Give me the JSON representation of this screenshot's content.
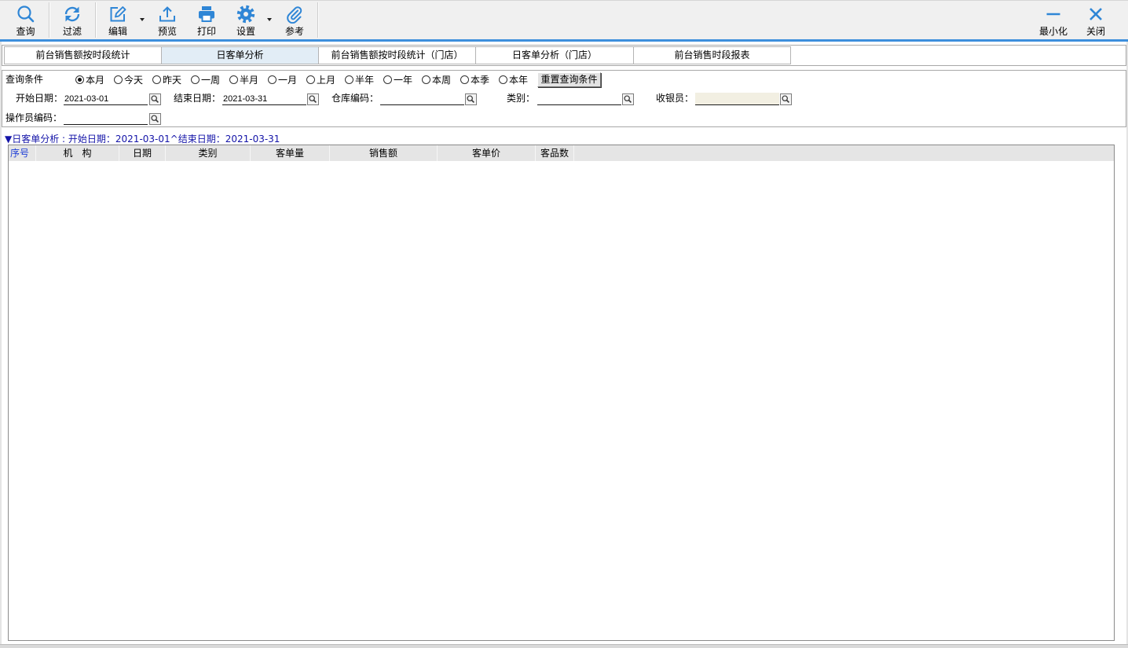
{
  "colors": {
    "accent": "#2f86d6",
    "toolbar_bg": "#f0f0f0",
    "divider_blue": "#3d8fdc",
    "active_tab_bg": "#e2edf6",
    "grid_header_bg": "#e5e5e5",
    "caption_text": "#1414a8",
    "header_blue_text": "#1f3fd6",
    "readonly_input_bg": "#f2efe2"
  },
  "toolbar": {
    "query": {
      "label": "查询",
      "icon": "search-icon"
    },
    "filter": {
      "label": "过滤",
      "icon": "refresh-icon"
    },
    "edit": {
      "label": "编辑",
      "icon": "edit-icon"
    },
    "preview": {
      "label": "预览",
      "icon": "upload-icon"
    },
    "print": {
      "label": "打印",
      "icon": "print-icon"
    },
    "settings": {
      "label": "设置",
      "icon": "gear-icon"
    },
    "reference": {
      "label": "参考",
      "icon": "paperclip-icon"
    },
    "minimize": {
      "label": "最小化",
      "icon": "minimize-icon"
    },
    "close": {
      "label": "关闭",
      "icon": "close-icon"
    }
  },
  "tabs": [
    {
      "label": "前台销售额按时段统计",
      "active": false
    },
    {
      "label": "日客单分析",
      "active": true
    },
    {
      "label": "前台销售额按时段统计（门店）",
      "active": false
    },
    {
      "label": "日客单分析（门店）",
      "active": false
    },
    {
      "label": "前台销售时段报表",
      "active": false
    }
  ],
  "query": {
    "title": "查询条件",
    "periods": [
      {
        "label": "本月",
        "selected": true
      },
      {
        "label": "今天",
        "selected": false
      },
      {
        "label": "昨天",
        "selected": false
      },
      {
        "label": "一周",
        "selected": false
      },
      {
        "label": "半月",
        "selected": false
      },
      {
        "label": "一月",
        "selected": false
      },
      {
        "label": "上月",
        "selected": false
      },
      {
        "label": "半年",
        "selected": false
      },
      {
        "label": "一年",
        "selected": false
      },
      {
        "label": "本周",
        "selected": false
      },
      {
        "label": "本季",
        "selected": false
      },
      {
        "label": "本年",
        "selected": false
      }
    ],
    "reset_label": "重置查询条件",
    "fields": {
      "start_date": {
        "label": "开始日期：",
        "value": "2021-03-01"
      },
      "end_date": {
        "label": "结束日期：",
        "value": "2021-03-31"
      },
      "warehouse_code": {
        "label": "仓库编码："
      },
      "category": {
        "label": "类别："
      },
      "cashier": {
        "label": "收银员："
      },
      "operator_code": {
        "label": "操作员编码："
      }
    }
  },
  "grid": {
    "caption": "▼日客单分析 : 开始日期：2021-03-01^结束日期：2021-03-31",
    "columns": [
      "序号",
      "机　构",
      "日期",
      "类别",
      "客单量",
      "销售额",
      "客单价",
      "客品数"
    ],
    "rows": []
  }
}
